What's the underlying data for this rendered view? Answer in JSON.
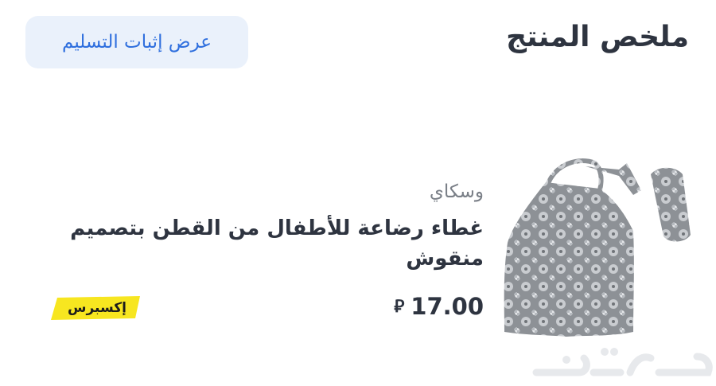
{
  "header": {
    "title": "ملخص المنتج",
    "proof_button_label": "عرض إثبات التسليم"
  },
  "product": {
    "seller": "وسكاي",
    "name": "غطاء رضاعة للأطفال من القطن بتصميم منقوش",
    "price": "17.00",
    "currency_icon": "riyal-icon",
    "badge_label": "إكسبرس",
    "image_icon": "nursing-cover-image"
  },
  "watermark": {
    "logo": "haraj-logo"
  },
  "colors": {
    "accent_blue": "#2f6fde",
    "button_bg": "#eaf1fb",
    "badge_yellow": "#f7e620",
    "text_dark": "#2e3440",
    "text_muted": "#7a7f87"
  }
}
